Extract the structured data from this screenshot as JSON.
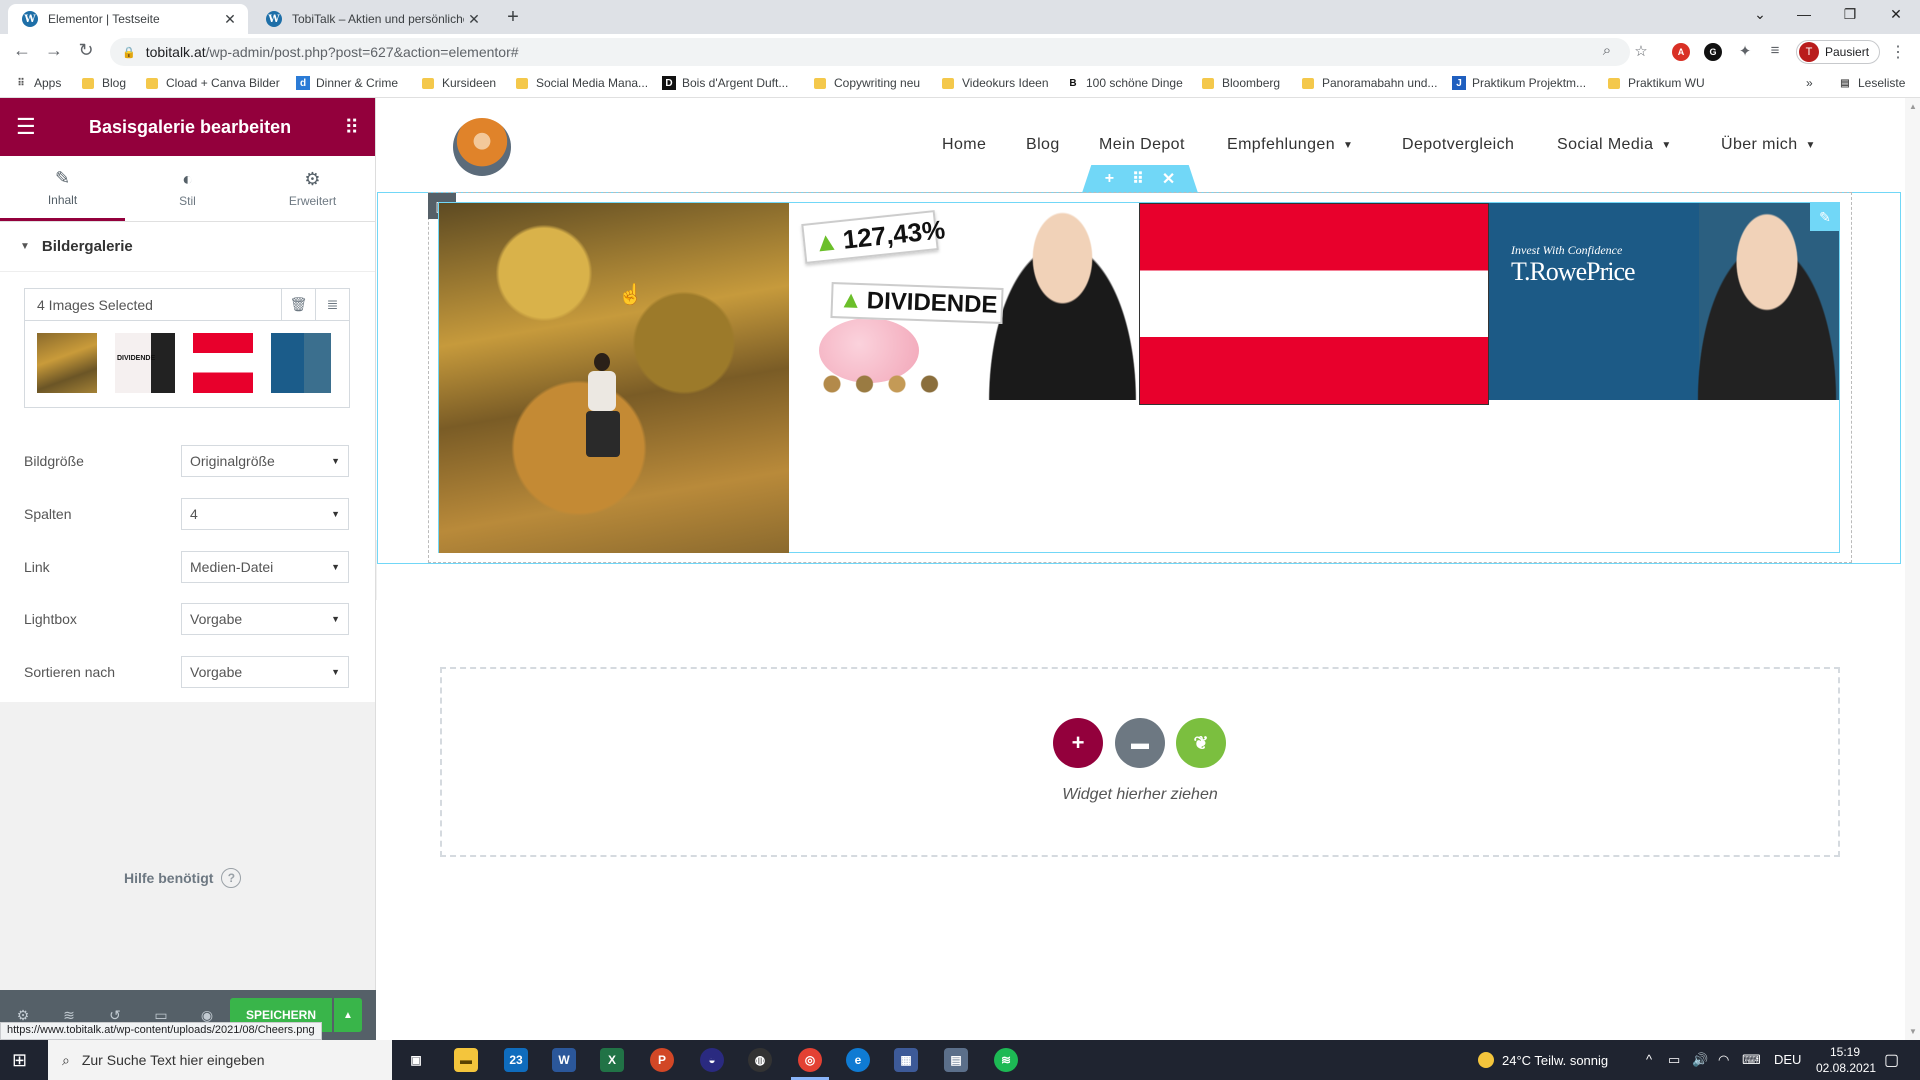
{
  "browser": {
    "tabs": [
      {
        "title": "Elementor | Testseite",
        "active": true
      },
      {
        "title": "TobiTalk – Aktien und persönliche",
        "active": false
      }
    ],
    "url_host": "tobitalk.at",
    "url_path": "/wp-admin/post.php?post=627&action=elementor#",
    "profile_initial": "T",
    "profile_label": "Pausiert",
    "bookmarks": [
      "Apps",
      "Blog",
      "Cload + Canva Bilder",
      "Dinner & Crime",
      "Kursideen",
      "Social Media Mana...",
      "Bois d'Argent Duft...",
      "Copywriting neu",
      "Videokurs Ideen",
      "100 schöne Dinge",
      "Bloomberg",
      "Panoramabahn und...",
      "Praktikum Projektm...",
      "Praktikum WU"
    ],
    "reading_list": "Leseliste"
  },
  "panel": {
    "title": "Basisgalerie bearbeiten",
    "tabs": [
      "Inhalt",
      "Stil",
      "Erweitert"
    ],
    "section_title": "Bildergalerie",
    "gallery_label": "4 Images Selected",
    "controls": [
      {
        "label": "Bildgröße",
        "value": "Originalgröße"
      },
      {
        "label": "Spalten",
        "value": "4"
      },
      {
        "label": "Link",
        "value": "Medien-Datei"
      },
      {
        "label": "Lightbox",
        "value": "Vorgabe"
      },
      {
        "label": "Sortieren nach",
        "value": "Vorgabe"
      }
    ],
    "help": "Hilfe benötigt",
    "save_label": "SPEICHERN",
    "status_url": "https://www.tobitalk.at/wp-content/uploads/2021/08/Cheers.png"
  },
  "site": {
    "nav": [
      {
        "label": "Home",
        "dropdown": false
      },
      {
        "label": "Blog",
        "dropdown": false
      },
      {
        "label": "Mein Depot",
        "dropdown": false
      },
      {
        "label": "Empfehlungen",
        "dropdown": true
      },
      {
        "label": "Depotvergleich",
        "dropdown": false
      },
      {
        "label": "Social Media",
        "dropdown": true
      },
      {
        "label": "Über mich",
        "dropdown": true
      }
    ],
    "gallery": {
      "img2_badge_percent": "127,43%",
      "img2_badge_word": "DIVIDENDE",
      "img4_slogan": "Invest With Confidence",
      "img4_brand": "T.RowePrice"
    },
    "drop_label": "Widget hierher ziehen"
  },
  "taskbar": {
    "search_placeholder": "Zur Suche Text hier eingeben",
    "mail_badge": "23",
    "weather": "24°C  Teilw. sonnig",
    "lang": "DEU",
    "time": "15:19",
    "date": "02.08.2021"
  },
  "colors": {
    "elementor_primary": "#93003c",
    "save_green": "#39b54a",
    "selection_blue": "#71d7f7"
  }
}
